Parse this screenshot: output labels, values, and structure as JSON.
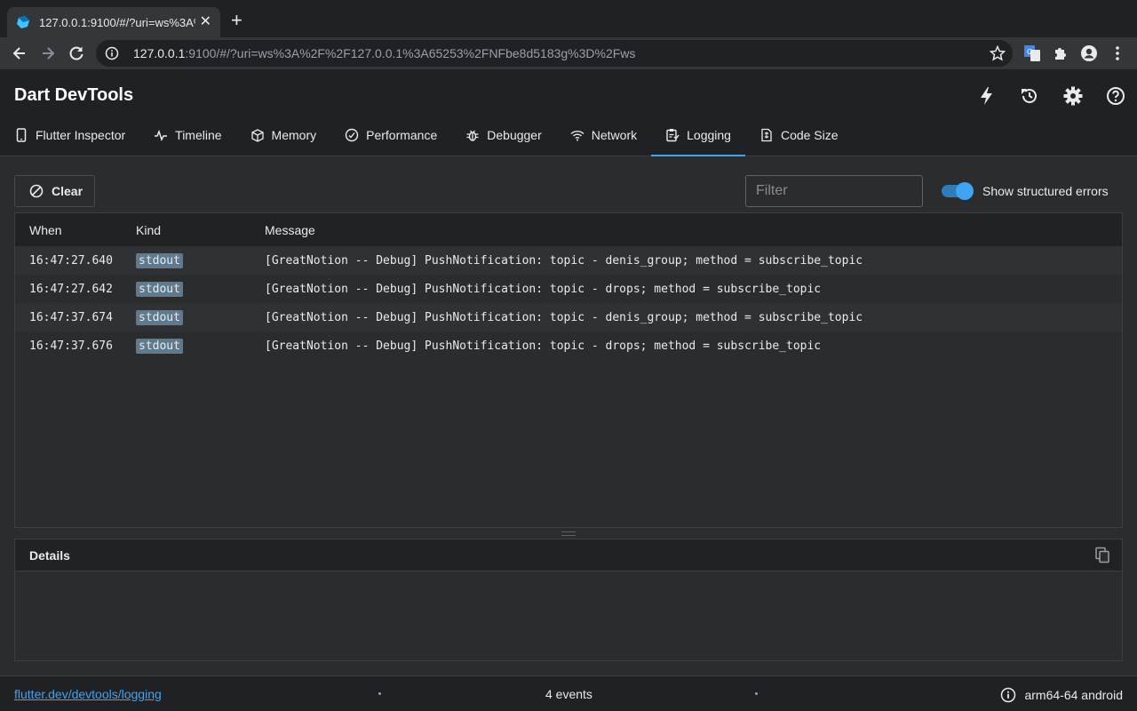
{
  "browser": {
    "tab_title": "127.0.0.1:9100/#/?uri=ws%3A%2",
    "url_host": "127.0.0.1",
    "url_rest": ":9100/#/?uri=ws%3A%2F%2F127.0.0.1%3A65253%2FNFbe8d5183g%3D%2Fws"
  },
  "app": {
    "title": "Dart DevTools",
    "tabs": [
      {
        "label": "Flutter Inspector",
        "icon": "phone-icon"
      },
      {
        "label": "Timeline",
        "icon": "timeline-icon"
      },
      {
        "label": "Memory",
        "icon": "memory-icon"
      },
      {
        "label": "Performance",
        "icon": "performance-icon"
      },
      {
        "label": "Debugger",
        "icon": "debugger-icon"
      },
      {
        "label": "Network",
        "icon": "network-icon"
      },
      {
        "label": "Logging",
        "icon": "logging-icon",
        "active": true
      },
      {
        "label": "Code Size",
        "icon": "code-size-icon"
      }
    ]
  },
  "controls": {
    "clear_label": "Clear",
    "filter_placeholder": "Filter",
    "structured_errors_label": "Show structured errors",
    "structured_errors_on": true
  },
  "log": {
    "columns": {
      "when": "When",
      "kind": "Kind",
      "message": "Message"
    },
    "rows": [
      {
        "when": "16:47:27.640",
        "kind": "stdout",
        "message": "[GreatNotion -- Debug] PushNotification: topic - denis_group; method = subscribe_topic"
      },
      {
        "when": "16:47:27.642",
        "kind": "stdout",
        "message": "[GreatNotion -- Debug] PushNotification: topic - drops; method = subscribe_topic"
      },
      {
        "when": "16:47:37.674",
        "kind": "stdout",
        "message": "[GreatNotion -- Debug] PushNotification: topic - denis_group; method = subscribe_topic"
      },
      {
        "when": "16:47:37.676",
        "kind": "stdout",
        "message": "[GreatNotion -- Debug] PushNotification: topic - drops; method = subscribe_topic"
      }
    ]
  },
  "details": {
    "title": "Details"
  },
  "status": {
    "link": "flutter.dev/devtools/logging",
    "events": "4 events",
    "device": "arm64-64 android"
  },
  "colors": {
    "accent": "#41a3f4",
    "kind_badge": "#5f7a8f"
  }
}
